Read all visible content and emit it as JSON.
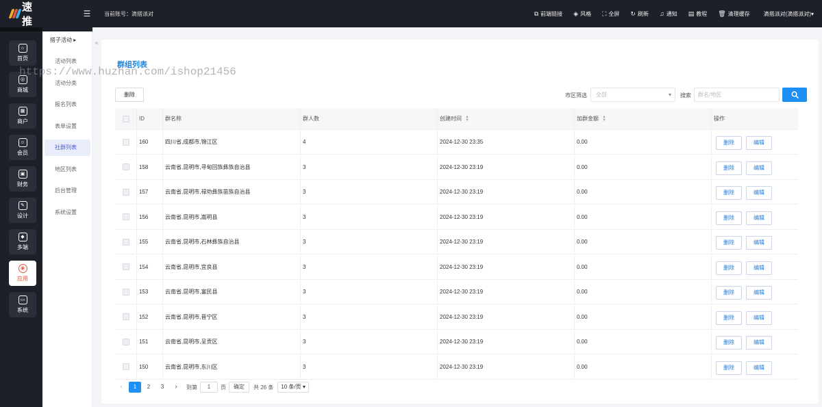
{
  "app": {
    "logo_text": "速推"
  },
  "topbar": {
    "account_label": "当前账号：滴搭派对",
    "items": [
      {
        "icon": "link-icon",
        "glyph": "⧉",
        "label": "前端链接"
      },
      {
        "icon": "palette-icon",
        "glyph": "◈",
        "label": "风格"
      },
      {
        "icon": "fullscreen-icon",
        "glyph": "⛶",
        "label": "全屏"
      },
      {
        "icon": "refresh-icon",
        "glyph": "↻",
        "label": "刷新"
      },
      {
        "icon": "bell-icon",
        "glyph": "♫",
        "label": "通知"
      },
      {
        "icon": "book-icon",
        "glyph": "▤",
        "label": "教程"
      },
      {
        "icon": "trash-icon",
        "glyph": "🗑",
        "label": "清理缓存"
      }
    ],
    "user_label": "滴搭派对(滴搭派对)▾"
  },
  "iconbar": [
    {
      "label": "首页",
      "icon": "home-icon",
      "glyph": "⌂",
      "active": false
    },
    {
      "label": "商城",
      "icon": "store-icon",
      "glyph": "◎",
      "active": false
    },
    {
      "label": "商户",
      "icon": "merchant-icon",
      "glyph": "▦",
      "active": false
    },
    {
      "label": "会员",
      "icon": "member-icon",
      "glyph": "☺",
      "active": false
    },
    {
      "label": "财务",
      "icon": "finance-icon",
      "glyph": "▣",
      "active": false
    },
    {
      "label": "设计",
      "icon": "design-icon",
      "glyph": "✎",
      "active": false
    },
    {
      "label": "多端",
      "icon": "cube-icon",
      "glyph": "◆",
      "active": false
    },
    {
      "label": "应用",
      "icon": "apps-icon",
      "glyph": "◉",
      "active": true
    },
    {
      "label": "系统",
      "icon": "system-icon",
      "glyph": "▭",
      "active": false
    }
  ],
  "submenu": {
    "title": "搭子活动 ▸",
    "items": [
      {
        "label": "活动列表",
        "active": false
      },
      {
        "label": "活动分类",
        "active": false
      },
      {
        "label": "报名列表",
        "active": false
      },
      {
        "label": "表单设置",
        "active": false
      },
      {
        "label": "社群列表",
        "active": true
      },
      {
        "label": "地区列表",
        "active": false
      },
      {
        "label": "后台管理",
        "active": false
      },
      {
        "label": "系统设置",
        "active": false
      }
    ]
  },
  "watermark": "https://www.huzhan.com/ishop21456",
  "main": {
    "title": "群组列表",
    "delete_label": "删除",
    "filter_label": "市区筛选",
    "filter_select_value": "全部",
    "search_label": "搜索",
    "search_placeholder": "群名/地区"
  },
  "table": {
    "columns": [
      "ID",
      "群名称",
      "群人数",
      "创建时间",
      "加群金额",
      "操作"
    ],
    "delete_label": "删除",
    "edit_label": "编辑",
    "rows": [
      {
        "id": "160",
        "name": "四川省,成都市,锦江区",
        "members": "4",
        "created": "2024-12-30 23:35",
        "fee": "0.00"
      },
      {
        "id": "158",
        "name": "云南省,昆明市,寻甸回族彝族自治县",
        "members": "3",
        "created": "2024-12-30 23:19",
        "fee": "0.00"
      },
      {
        "id": "157",
        "name": "云南省,昆明市,禄劝彝族苗族自治县",
        "members": "3",
        "created": "2024-12-30 23:19",
        "fee": "0.00"
      },
      {
        "id": "156",
        "name": "云南省,昆明市,嵩明县",
        "members": "3",
        "created": "2024-12-30 23:19",
        "fee": "0.00"
      },
      {
        "id": "155",
        "name": "云南省,昆明市,石林彝族自治县",
        "members": "3",
        "created": "2024-12-30 23:19",
        "fee": "0.00"
      },
      {
        "id": "154",
        "name": "云南省,昆明市,宜良县",
        "members": "3",
        "created": "2024-12-30 23:19",
        "fee": "0.00"
      },
      {
        "id": "153",
        "name": "云南省,昆明市,富民县",
        "members": "3",
        "created": "2024-12-30 23:19",
        "fee": "0.00"
      },
      {
        "id": "152",
        "name": "云南省,昆明市,晋宁区",
        "members": "3",
        "created": "2024-12-30 23:19",
        "fee": "0.00"
      },
      {
        "id": "151",
        "name": "云南省,昆明市,呈贡区",
        "members": "3",
        "created": "2024-12-30 23:19",
        "fee": "0.00"
      },
      {
        "id": "150",
        "name": "云南省,昆明市,东川区",
        "members": "3",
        "created": "2024-12-30 23:19",
        "fee": "0.00"
      }
    ]
  },
  "pagination": {
    "pages": [
      "1",
      "2",
      "3"
    ],
    "current": "1",
    "goto_label": "到第",
    "goto_value": "1",
    "page_unit": "页",
    "confirm_label": "确定",
    "total_label": "共 26 条",
    "page_size_label": "10 条/页 ▾"
  },
  "colors": {
    "accent": "#1e90f4",
    "active_nav": "#e8563c",
    "dark_bg": "#1e2029",
    "title_blue": "#1a86e0"
  }
}
